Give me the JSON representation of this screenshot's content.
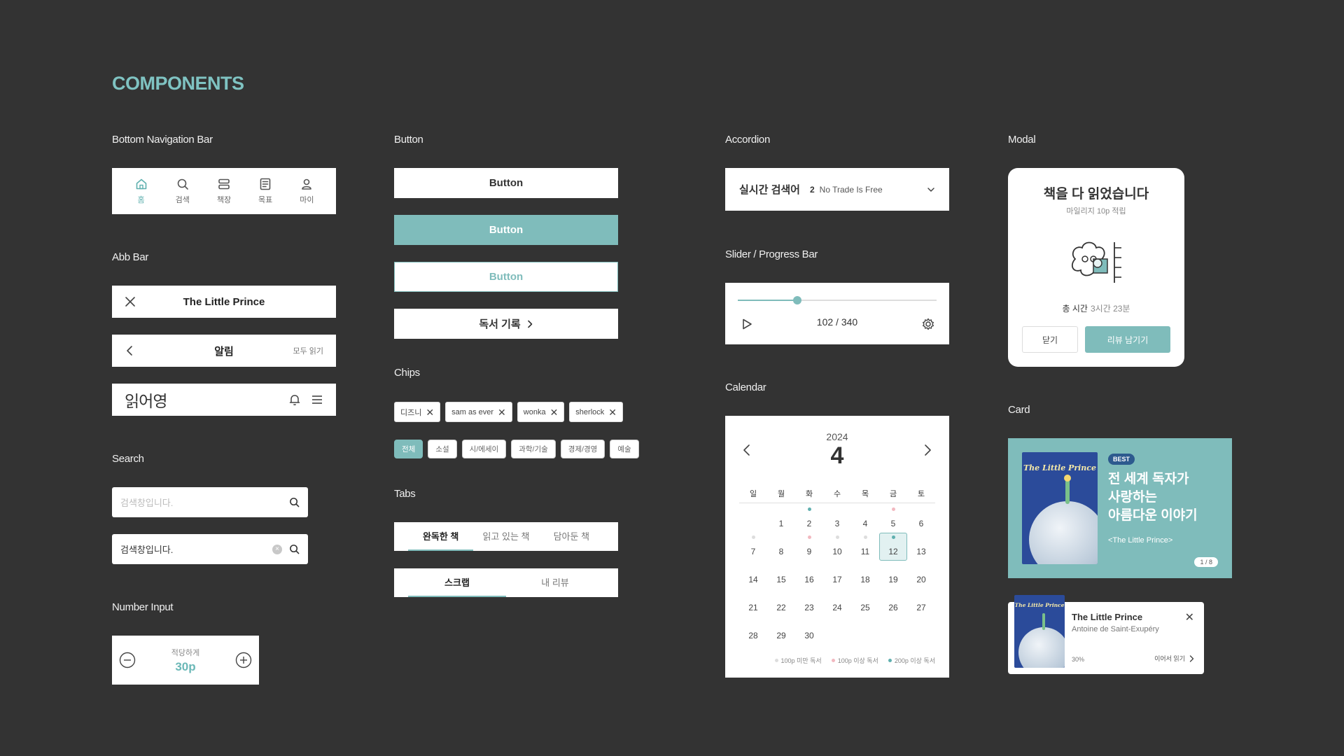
{
  "page": {
    "title": "COMPONENTS"
  },
  "sections": {
    "bottom_nav": "Bottom Navigation Bar",
    "app_bar": "Abb Bar",
    "search": "Search",
    "number_input": "Number Input",
    "button": "Button",
    "chips": "Chips",
    "tabs": "Tabs",
    "accordion": "Accordion",
    "slider": "Slider / Progress Bar",
    "calendar": "Calendar",
    "modal": "Modal",
    "card": "Card"
  },
  "bottom_nav": {
    "items": [
      {
        "label": "홈",
        "icon": "home-icon",
        "active": true
      },
      {
        "label": "검색",
        "icon": "search-icon"
      },
      {
        "label": "책장",
        "icon": "bookshelf-icon"
      },
      {
        "label": "목표",
        "icon": "goal-icon"
      },
      {
        "label": "마이",
        "icon": "user-icon"
      }
    ]
  },
  "app_bars": {
    "bar1": {
      "title": "The Little Prince",
      "left_icon": "close-icon"
    },
    "bar2": {
      "title": "알림",
      "left_icon": "chevron-left-icon",
      "right_link": "모두 읽기"
    },
    "bar3": {
      "logo": "읽어영",
      "icons": [
        "bell-icon",
        "menu-icon"
      ]
    }
  },
  "search": {
    "empty": {
      "placeholder": "검색창입니다."
    },
    "filled": {
      "value": "검색창입니다."
    }
  },
  "number_input": {
    "caption": "적당하게",
    "value": "30p"
  },
  "buttons": {
    "white": "Button",
    "teal": "Button",
    "outline": "Button",
    "record": "독서 기록"
  },
  "chips": {
    "removable": [
      "디즈니",
      "sam as ever",
      "wonka",
      "sherlock"
    ],
    "categories": [
      "전체",
      "소설",
      "시/에세이",
      "과학/기술",
      "경제/경영",
      "예술"
    ],
    "active_category": "전체"
  },
  "tabs": {
    "set1": [
      "완독한 책",
      "읽고 있는 책",
      "담아둔 책"
    ],
    "set1_active": 0,
    "set2": [
      "스크랩",
      "내 리뷰"
    ],
    "set2_active": 0
  },
  "accordion": {
    "title": "실시간 검색어",
    "rank": "2",
    "text": "No Trade Is Free"
  },
  "slider": {
    "current": 102,
    "total": 340,
    "label": "102 / 340"
  },
  "calendar": {
    "year": "2024",
    "month": "4",
    "weekdays": [
      "일",
      "월",
      "화",
      "수",
      "목",
      "금",
      "토"
    ],
    "start_offset": 1,
    "days": 30,
    "selected": 12,
    "reading_dots": {
      "2": "#5fb0af",
      "5": "#f2b8c0",
      "7": "#dddddd",
      "9": "#f2b8c0",
      "10": "#dddddd",
      "11": "#dddddd",
      "12": "#5fb0af"
    },
    "legend": [
      {
        "label": "100p 미만 독서",
        "color": "#dddddd"
      },
      {
        "label": "100p 이상 독서",
        "color": "#f2b8c0"
      },
      {
        "label": "200p 이상 독서",
        "color": "#5fb0af"
      }
    ]
  },
  "modal": {
    "title": "책을 다 읽었습니다",
    "subtitle": "마일리지 10p 적립",
    "time_label": "총 시간",
    "time_value": "3시간 23분",
    "close_label": "닫기",
    "review_label": "리뷰 남기기"
  },
  "card_banner": {
    "badge": "BEST",
    "line1": "전 세계 독자가",
    "line2": "사랑하는",
    "line3": "아름다운 이야기",
    "subtitle": "<The Little Prince>",
    "pager": "1 / 8",
    "cover_title": "The Little Prince"
  },
  "card_book": {
    "title": "The Little Prince",
    "author": "Antoine de Saint-Exupéry",
    "progress": "30%",
    "continue": "이어서 읽기",
    "cover_title": "The Little Prince"
  },
  "colors": {
    "accent": "#7fbcbb",
    "background": "#333333"
  }
}
